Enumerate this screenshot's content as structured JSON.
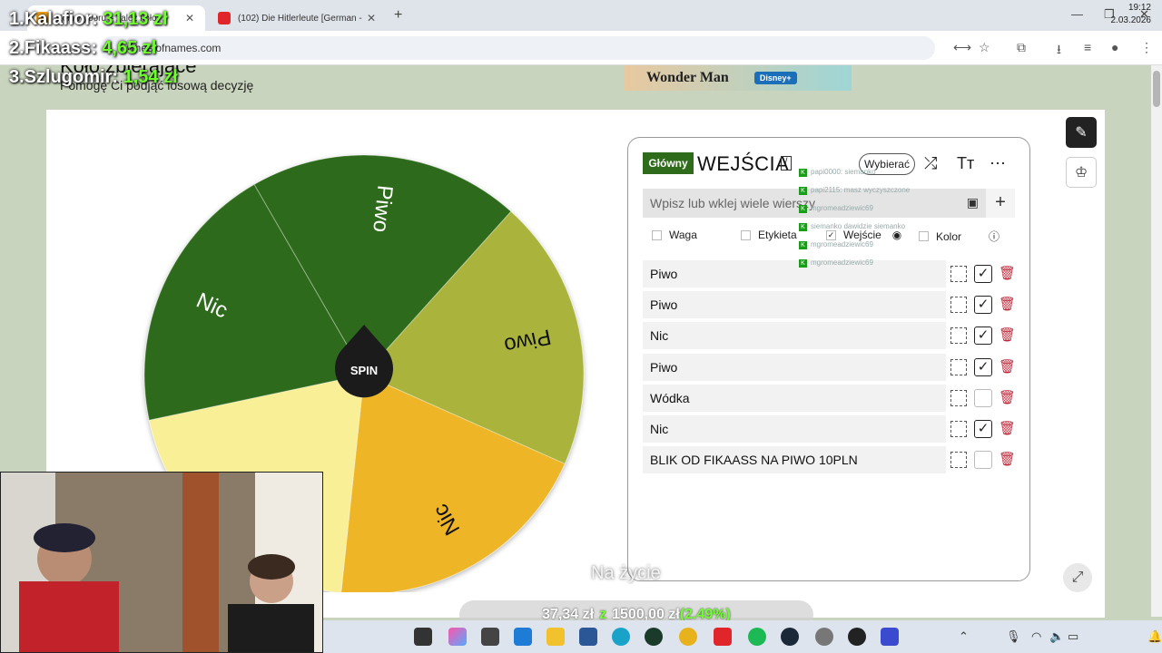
{
  "browser": {
    "tabs": [
      {
        "title": "Koło wyboru – zależ koło",
        "active": true
      },
      {
        "title": "(102) Die Hitlerleute [German -",
        "active": false
      }
    ],
    "url": "wheelofnames.com"
  },
  "page": {
    "title": "Koło zbierające",
    "subtitle": "Pomogę Ci podjąć losową decyzję",
    "ad": {
      "brand": "Wonder Man",
      "network": "Disney+"
    }
  },
  "wheel": {
    "center_label": "SPIN",
    "segments": [
      {
        "label": "Piwo",
        "color": "#2e6b1a"
      },
      {
        "label": "Piwo",
        "color": "#aab43e"
      },
      {
        "label": "Nic",
        "color": "#eeb526"
      },
      {
        "label": "Wódka",
        "color": "#f9ef97"
      },
      {
        "label": "Nic",
        "color": "#2e6b1a"
      }
    ]
  },
  "entries_panel": {
    "group_label": "Główny",
    "title": "WEJŚCIA",
    "choose_button": "Wybierać",
    "input_placeholder": "Wpisz lub wklej wiele wierszy",
    "columns": {
      "weight": "Waga",
      "label": "Etykieta",
      "entry": "Wejście",
      "color": "Kolor"
    },
    "entries": [
      {
        "text": "Piwo",
        "checked": true
      },
      {
        "text": "Piwo",
        "checked": true
      },
      {
        "text": "Nic",
        "checked": true
      },
      {
        "text": "Piwo",
        "checked": true
      },
      {
        "text": "Wódka",
        "checked": false
      },
      {
        "text": "Nic",
        "checked": true
      },
      {
        "text": "BLIK OD FIKAASS NA PIWO 10PLN",
        "checked": false
      }
    ]
  },
  "overlay": {
    "leaderboard": [
      {
        "rank": "1.",
        "name": "Kalafior:",
        "amount": "31,13 zł"
      },
      {
        "rank": "2.",
        "name": "Fikaass:",
        "amount": "4,65 zł"
      },
      {
        "rank": "3.",
        "name": "Szlugomir:",
        "amount": "1,54 zł"
      }
    ],
    "chat": [
      "papi0000: siemanko",
      "papi2115: masz wyczyszczone",
      "mgromeadziewic69",
      "siemanko dawidzie siemanko",
      "mgromeadziewic69",
      "mgromeadziewic69"
    ],
    "caption": "Na życie",
    "goal": {
      "current": "37,34 zł",
      "separator": "z",
      "target": "1500,00 zł",
      "percent": "(2.49%)"
    }
  },
  "taskbar": {
    "time": "19:12",
    "date": "2.03.2026"
  }
}
